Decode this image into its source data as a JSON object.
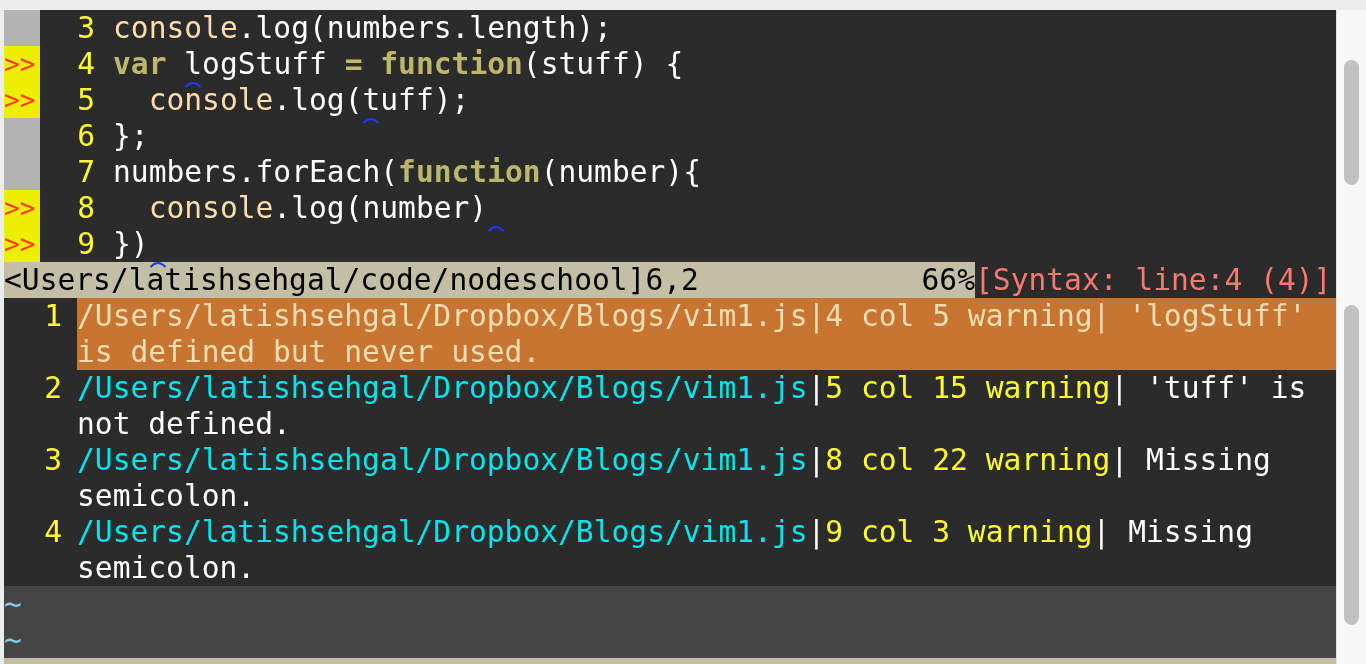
{
  "editor": {
    "lines": [
      {
        "number": "3",
        "segments": [
          {
            "text": "console",
            "kind": "builtin"
          },
          {
            "text": ".log(numbers.length);",
            "kind": "plain"
          }
        ]
      },
      {
        "number": "4",
        "sign": ">>",
        "segments": [
          {
            "text": "var ",
            "kind": "keyword"
          },
          {
            "text": "l",
            "kind": "plain",
            "marked": true
          },
          {
            "text": "ogStuff ",
            "kind": "plain"
          },
          {
            "text": "= ",
            "kind": "keyword"
          },
          {
            "text": "function",
            "kind": "keyword"
          },
          {
            "text": "(stuff) {",
            "kind": "plain"
          }
        ]
      },
      {
        "number": "5",
        "sign": ">>",
        "segments": [
          {
            "text": "  console",
            "kind": "builtin"
          },
          {
            "text": ".log(",
            "kind": "plain"
          },
          {
            "text": "t",
            "kind": "plain",
            "marked": true
          },
          {
            "text": "uff);",
            "kind": "plain"
          }
        ]
      },
      {
        "number": "6",
        "segments": [
          {
            "text": "};",
            "kind": "plain"
          }
        ]
      },
      {
        "number": "7",
        "segments": [
          {
            "text": "numbers.forEach(",
            "kind": "plain"
          },
          {
            "text": "function",
            "kind": "keyword"
          },
          {
            "text": "(number){",
            "kind": "plain"
          }
        ]
      },
      {
        "number": "8",
        "sign": ">>",
        "segments": [
          {
            "text": "  console",
            "kind": "builtin"
          },
          {
            "text": ".log(number)",
            "kind": "plain",
            "marked_after": true
          }
        ]
      },
      {
        "number": "9",
        "sign": ">>",
        "segments": [
          {
            "text": "})",
            "kind": "plain",
            "marked_after": true
          }
        ]
      }
    ]
  },
  "status_line": {
    "path": "<Users/latishsehgal/code/nodeschool]6,2",
    "percent": "66%",
    "syntax": "[Syntax: line:4 (4)]"
  },
  "quickfix": {
    "entries": [
      {
        "number": "1",
        "selected": true,
        "file": "/Users/latishsehgal/Dropbox/Blogs/vim1.js",
        "separators": [
          "|",
          "|"
        ],
        "location": "4 col 5 warning",
        "message": "'logStuff' is defined but never used."
      },
      {
        "number": "2",
        "selected": false,
        "file": "/Users/latishsehgal/Dropbox/Blogs/vim1.js",
        "separators": [
          "|",
          "|"
        ],
        "location": "5 col 15 warning",
        "message": "'tuff' is not defined."
      },
      {
        "number": "3",
        "selected": false,
        "file": "/Users/latishsehgal/Dropbox/Blogs/vim1.js",
        "separators": [
          "|",
          "|"
        ],
        "location": "8 col 22 warning",
        "message": "Missing semicolon."
      },
      {
        "number": "4",
        "selected": false,
        "file": "/Users/latishsehgal/Dropbox/Blogs/vim1.js",
        "separators": [
          "|",
          "|"
        ],
        "location": "9 col 3 warning",
        "message": "Missing semicolon."
      }
    ],
    "filler": [
      "~",
      "~"
    ]
  }
}
